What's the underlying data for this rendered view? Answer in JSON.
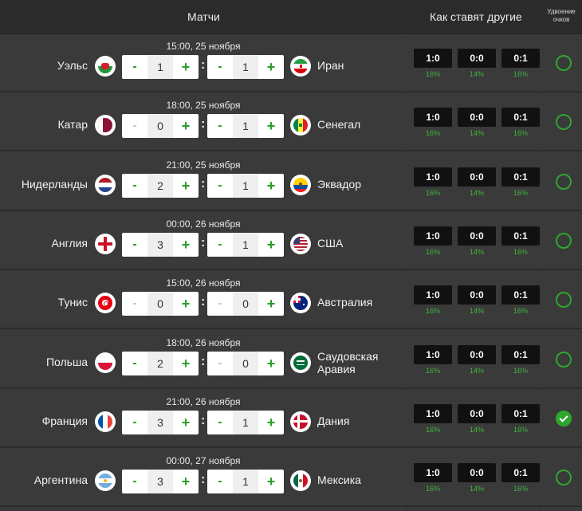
{
  "header": {
    "matches": "Матчи",
    "others": "Как ставят другие",
    "double": "Удвоение очков"
  },
  "colors": {
    "accent": "#2a9d2a",
    "row_bg": "#3a3a3a",
    "pick_bg": "#111111"
  },
  "matches": [
    {
      "time": "15:00, 25 ноября",
      "home": "Уэльс",
      "home_flag": "wales-flag-icon",
      "home_score": "1",
      "away": "Иран",
      "away_flag": "iran-flag-icon",
      "away_score": "1",
      "picks": [
        {
          "score": "1:0",
          "pct": "16%"
        },
        {
          "score": "0:0",
          "pct": "14%"
        },
        {
          "score": "0:1",
          "pct": "16%"
        }
      ],
      "doubled": false
    },
    {
      "time": "18:00, 25 ноября",
      "home": "Катар",
      "home_flag": "qatar-flag-icon",
      "home_score": "0",
      "away": "Сенегал",
      "away_flag": "senegal-flag-icon",
      "away_score": "1",
      "picks": [
        {
          "score": "1:0",
          "pct": "16%"
        },
        {
          "score": "0:0",
          "pct": "14%"
        },
        {
          "score": "0:1",
          "pct": "16%"
        }
      ],
      "doubled": false
    },
    {
      "time": "21:00, 25 ноября",
      "home": "Нидерланды",
      "home_flag": "netherlands-flag-icon",
      "home_score": "2",
      "away": "Эквадор",
      "away_flag": "ecuador-flag-icon",
      "away_score": "1",
      "picks": [
        {
          "score": "1:0",
          "pct": "16%"
        },
        {
          "score": "0:0",
          "pct": "14%"
        },
        {
          "score": "0:1",
          "pct": "16%"
        }
      ],
      "doubled": false
    },
    {
      "time": "00:00, 26 ноября",
      "home": "Англия",
      "home_flag": "england-flag-icon",
      "home_score": "3",
      "away": "США",
      "away_flag": "usa-flag-icon",
      "away_score": "1",
      "picks": [
        {
          "score": "1:0",
          "pct": "16%"
        },
        {
          "score": "0:0",
          "pct": "14%"
        },
        {
          "score": "0:1",
          "pct": "16%"
        }
      ],
      "doubled": false
    },
    {
      "time": "15:00, 26 ноября",
      "home": "Тунис",
      "home_flag": "tunisia-flag-icon",
      "home_score": "0",
      "away": "Австралия",
      "away_flag": "australia-flag-icon",
      "away_score": "0",
      "picks": [
        {
          "score": "1:0",
          "pct": "16%"
        },
        {
          "score": "0:0",
          "pct": "14%"
        },
        {
          "score": "0:1",
          "pct": "16%"
        }
      ],
      "doubled": false
    },
    {
      "time": "18:00, 26 ноября",
      "home": "Польша",
      "home_flag": "poland-flag-icon",
      "home_score": "2",
      "away": "Саудовская Аравия",
      "away_flag": "saudi-arabia-flag-icon",
      "away_score": "0",
      "picks": [
        {
          "score": "1:0",
          "pct": "16%"
        },
        {
          "score": "0:0",
          "pct": "14%"
        },
        {
          "score": "0:1",
          "pct": "16%"
        }
      ],
      "doubled": false
    },
    {
      "time": "21:00, 26 ноября",
      "home": "Франция",
      "home_flag": "france-flag-icon",
      "home_score": "3",
      "away": "Дания",
      "away_flag": "denmark-flag-icon",
      "away_score": "1",
      "picks": [
        {
          "score": "1:0",
          "pct": "16%"
        },
        {
          "score": "0:0",
          "pct": "14%"
        },
        {
          "score": "0:1",
          "pct": "16%"
        }
      ],
      "doubled": true
    },
    {
      "time": "00:00, 27 ноября",
      "home": "Аргентина",
      "home_flag": "argentina-flag-icon",
      "home_score": "3",
      "away": "Мексика",
      "away_flag": "mexico-flag-icon",
      "away_score": "1",
      "picks": [
        {
          "score": "1:0",
          "pct": "16%"
        },
        {
          "score": "0:0",
          "pct": "14%"
        },
        {
          "score": "0:1",
          "pct": "16%"
        }
      ],
      "doubled": false
    }
  ]
}
